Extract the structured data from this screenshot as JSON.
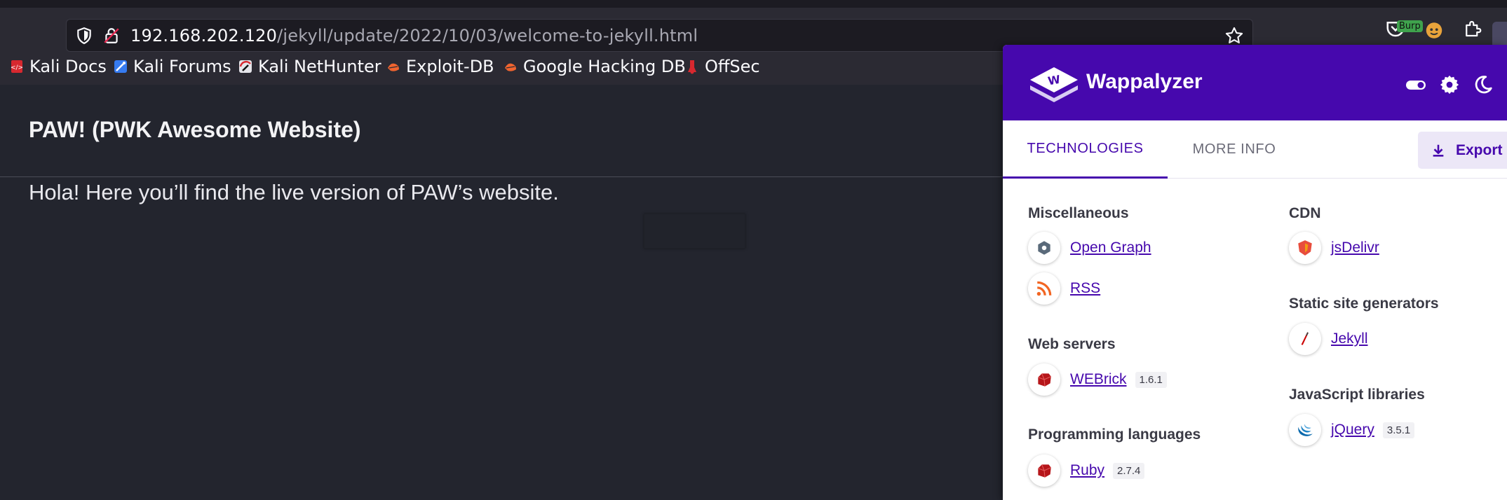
{
  "browser": {
    "url_host": "192.168.202.120",
    "url_path": "/jekyll/update/2022/10/03/welcome-to-jekyll.html",
    "burp_badge": "Burp"
  },
  "bookmarks": [
    {
      "label": "Kali Docs",
      "icon": "kali-docs-icon"
    },
    {
      "label": "Kali Forums",
      "icon": "kali-forums-icon"
    },
    {
      "label": "Kali NetHunter",
      "icon": "kali-nethunter-icon"
    },
    {
      "label": "Exploit-DB",
      "icon": "exploit-db-icon"
    },
    {
      "label": "Google Hacking DB",
      "icon": "ghdb-icon"
    },
    {
      "label": "OffSec",
      "icon": "offsec-icon"
    }
  ],
  "page": {
    "title": "PAW! (PWK Awesome Website)",
    "intro": "Hola! Here you’ll find the live version of PAW’s website."
  },
  "wappalyzer": {
    "name": "Wappalyzer",
    "brand_color": "#4608ad",
    "tabs": [
      {
        "label": "TECHNOLOGIES",
        "active": true
      },
      {
        "label": "MORE INFO",
        "active": false
      }
    ],
    "export_label": "Export",
    "categories": {
      "misc": {
        "title": "Miscellaneous",
        "items": [
          {
            "name": "Open Graph",
            "version": "",
            "icon": "open-graph-icon"
          },
          {
            "name": "RSS",
            "version": "",
            "icon": "rss-icon"
          }
        ]
      },
      "webservers": {
        "title": "Web servers",
        "items": [
          {
            "name": "WEBrick",
            "version": "1.6.1",
            "icon": "ruby-gem-icon"
          }
        ]
      },
      "proglang": {
        "title": "Programming languages",
        "items": [
          {
            "name": "Ruby",
            "version": "2.7.4",
            "icon": "ruby-gem-icon"
          }
        ]
      },
      "cdn": {
        "title": "CDN",
        "items": [
          {
            "name": "jsDelivr",
            "version": "",
            "icon": "jsdelivr-icon"
          }
        ]
      },
      "ssg": {
        "title": "Static site generators",
        "items": [
          {
            "name": "Jekyll",
            "version": "",
            "icon": "jekyll-icon"
          }
        ]
      },
      "jslib": {
        "title": "JavaScript libraries",
        "items": [
          {
            "name": "jQuery",
            "version": "3.5.1",
            "icon": "jquery-icon"
          }
        ]
      }
    }
  }
}
